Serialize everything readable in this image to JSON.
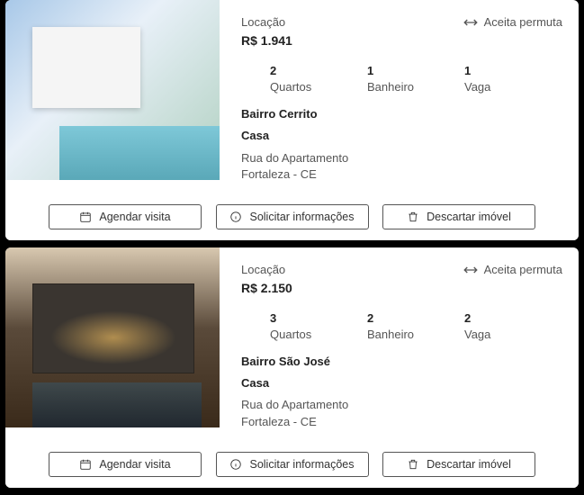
{
  "listings": [
    {
      "lease_label": "Locação",
      "price": "R$ 1.941",
      "permuta_label": "Aceita permuta",
      "stats": {
        "rooms_num": "2",
        "rooms_label": "Quartos",
        "baths_num": "1",
        "baths_label": "Banheiro",
        "spots_num": "1",
        "spots_label": "Vaga"
      },
      "neighborhood": "Bairro Cerrito",
      "proptype": "Casa",
      "address_line1": "Rua do Apartamento",
      "address_line2": "Fortaleza - CE"
    },
    {
      "lease_label": "Locação",
      "price": "R$ 2.150",
      "permuta_label": "Aceita permuta",
      "stats": {
        "rooms_num": "3",
        "rooms_label": "Quartos",
        "baths_num": "2",
        "baths_label": "Banheiro",
        "spots_num": "2",
        "spots_label": "Vaga"
      },
      "neighborhood": "Bairro São José",
      "proptype": "Casa",
      "address_line1": "Rua do Apartamento",
      "address_line2": "Fortaleza - CE"
    }
  ],
  "buttons": {
    "schedule": "Agendar visita",
    "request": "Solicitar informações",
    "discard": "Descartar imóvel"
  }
}
